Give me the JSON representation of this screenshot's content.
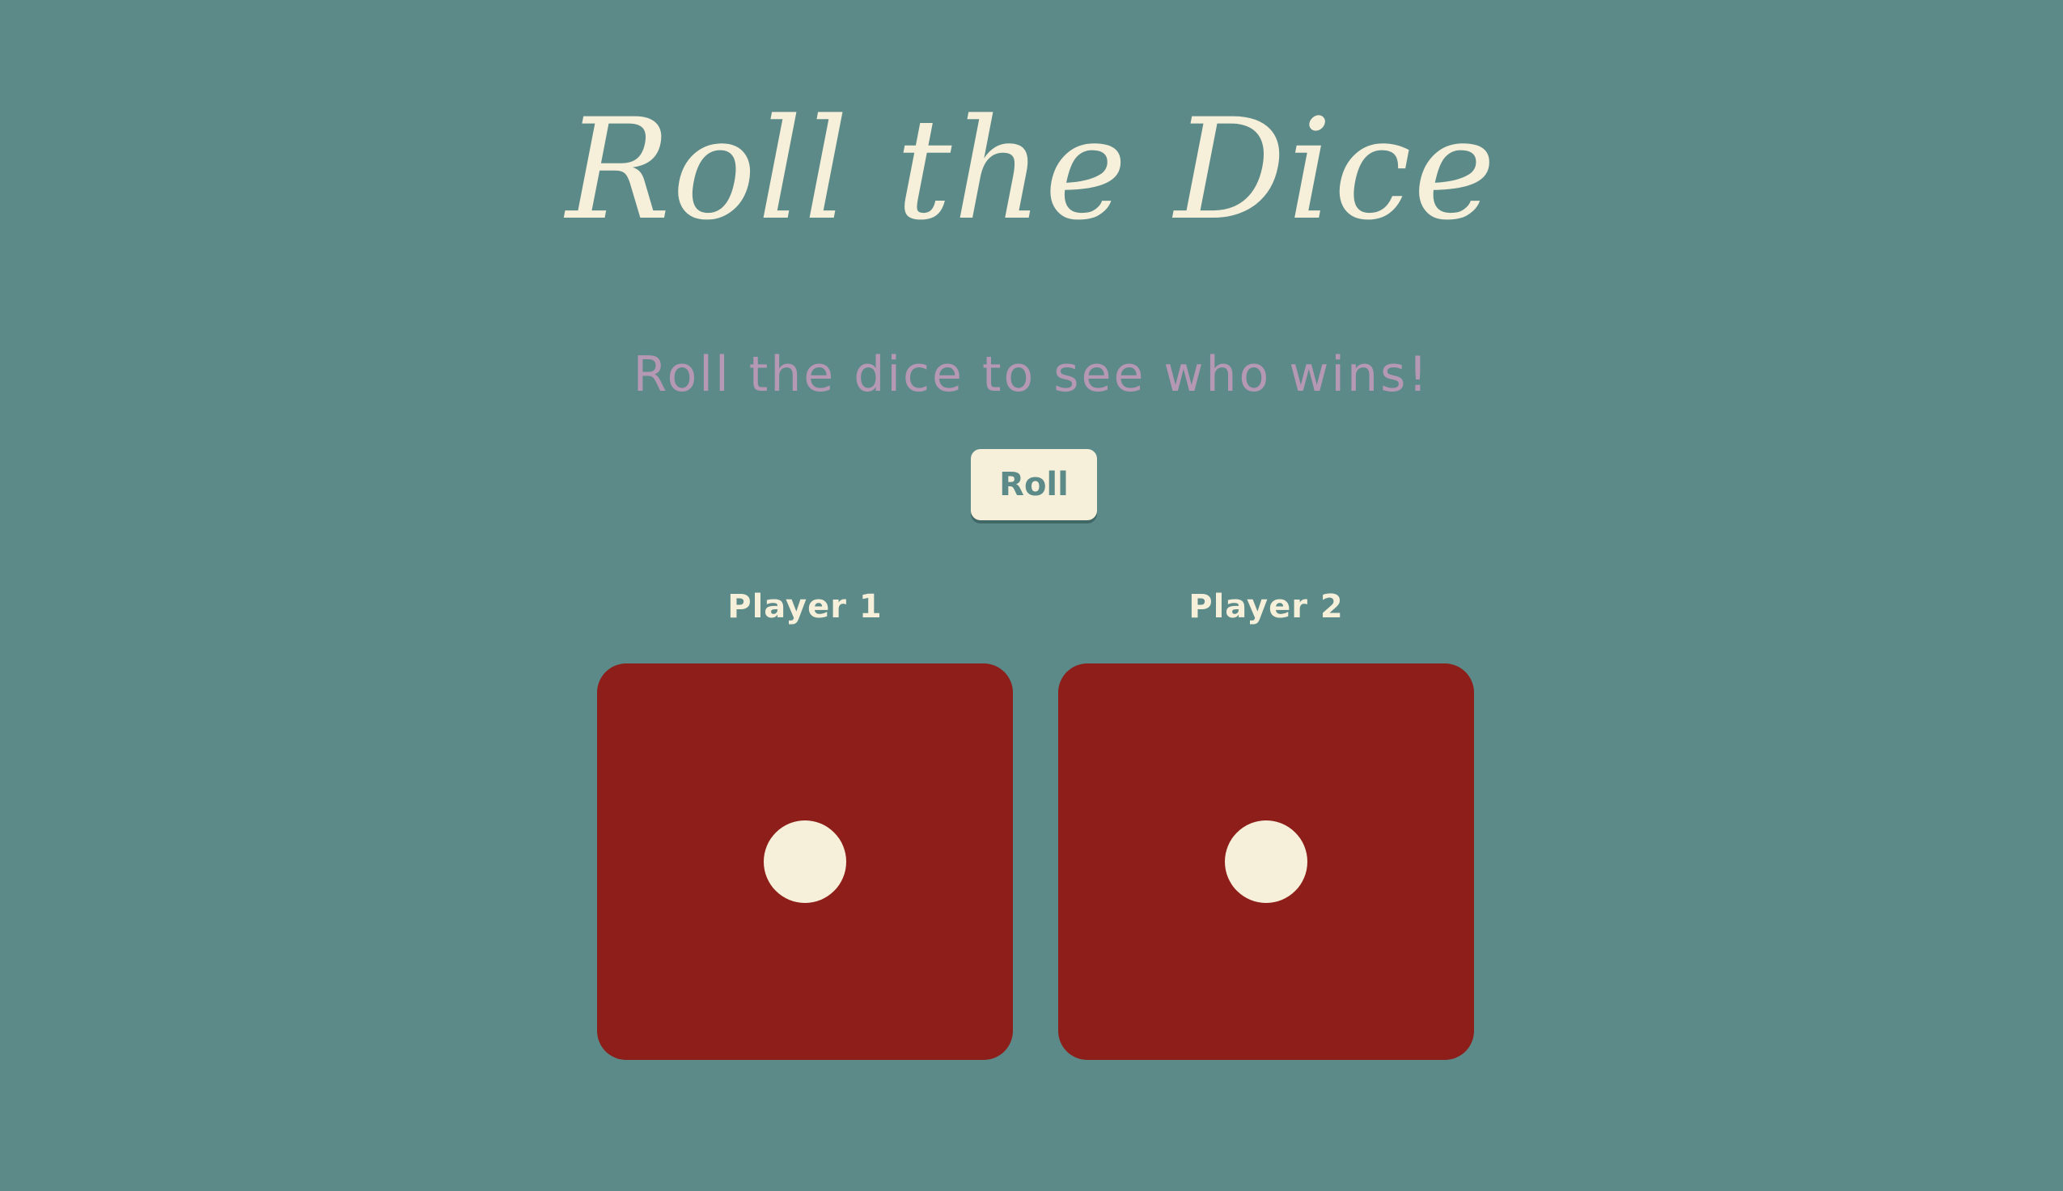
{
  "title": "Roll the Dice",
  "subtitle": "Roll the dice to see who wins!",
  "roll_button_label": "Roll",
  "players": [
    {
      "label": "Player 1",
      "die_value": 1
    },
    {
      "label": "Player 2",
      "die_value": 1
    }
  ],
  "colors": {
    "background": "#5c8a89",
    "title": "#f6efd9",
    "subtitle": "#b598b4",
    "die": "#8d1e19",
    "pip": "#f6efd9",
    "button_bg": "#f6efd9",
    "button_text": "#5c8a89"
  }
}
